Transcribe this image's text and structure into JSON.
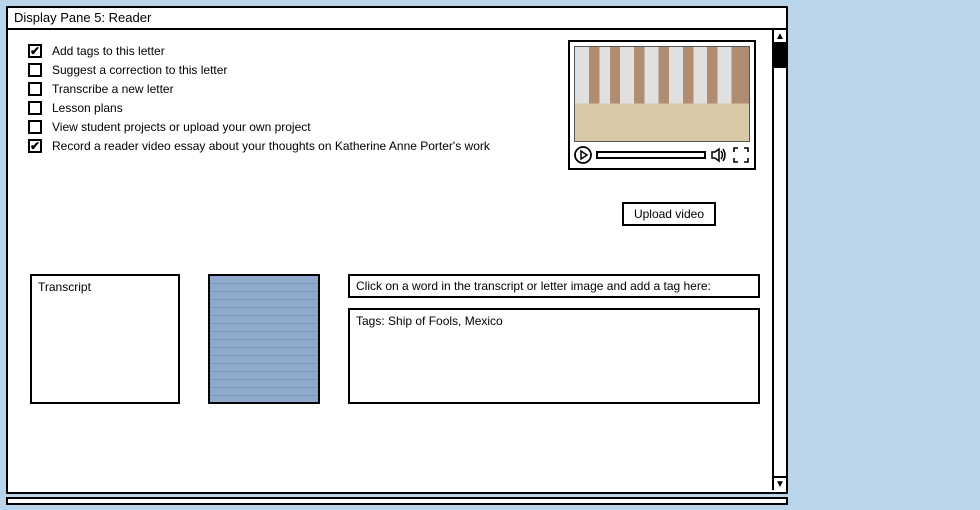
{
  "window": {
    "title": "Display Pane 5: Reader"
  },
  "checklist": {
    "items": [
      {
        "checked": true,
        "label": "Add tags to this letter"
      },
      {
        "checked": false,
        "label": "Suggest a correction to this letter"
      },
      {
        "checked": false,
        "label": "Transcribe a new letter"
      },
      {
        "checked": false,
        "label": "Lesson plans"
      },
      {
        "checked": false,
        "label": "View student projects or upload your own project"
      },
      {
        "checked": true,
        "label": "Record a reader video essay about your thoughts on Katherine Anne Porter's work"
      }
    ]
  },
  "video": {
    "upload_label": "Upload video"
  },
  "transcript": {
    "heading": "Transcript"
  },
  "tagging": {
    "hint": "Click on a word in the transcript or letter image and add a tag here:",
    "tags_label": "Tags: Ship of Fools, Mexico"
  },
  "glyphs": {
    "checkmark": "✔"
  }
}
